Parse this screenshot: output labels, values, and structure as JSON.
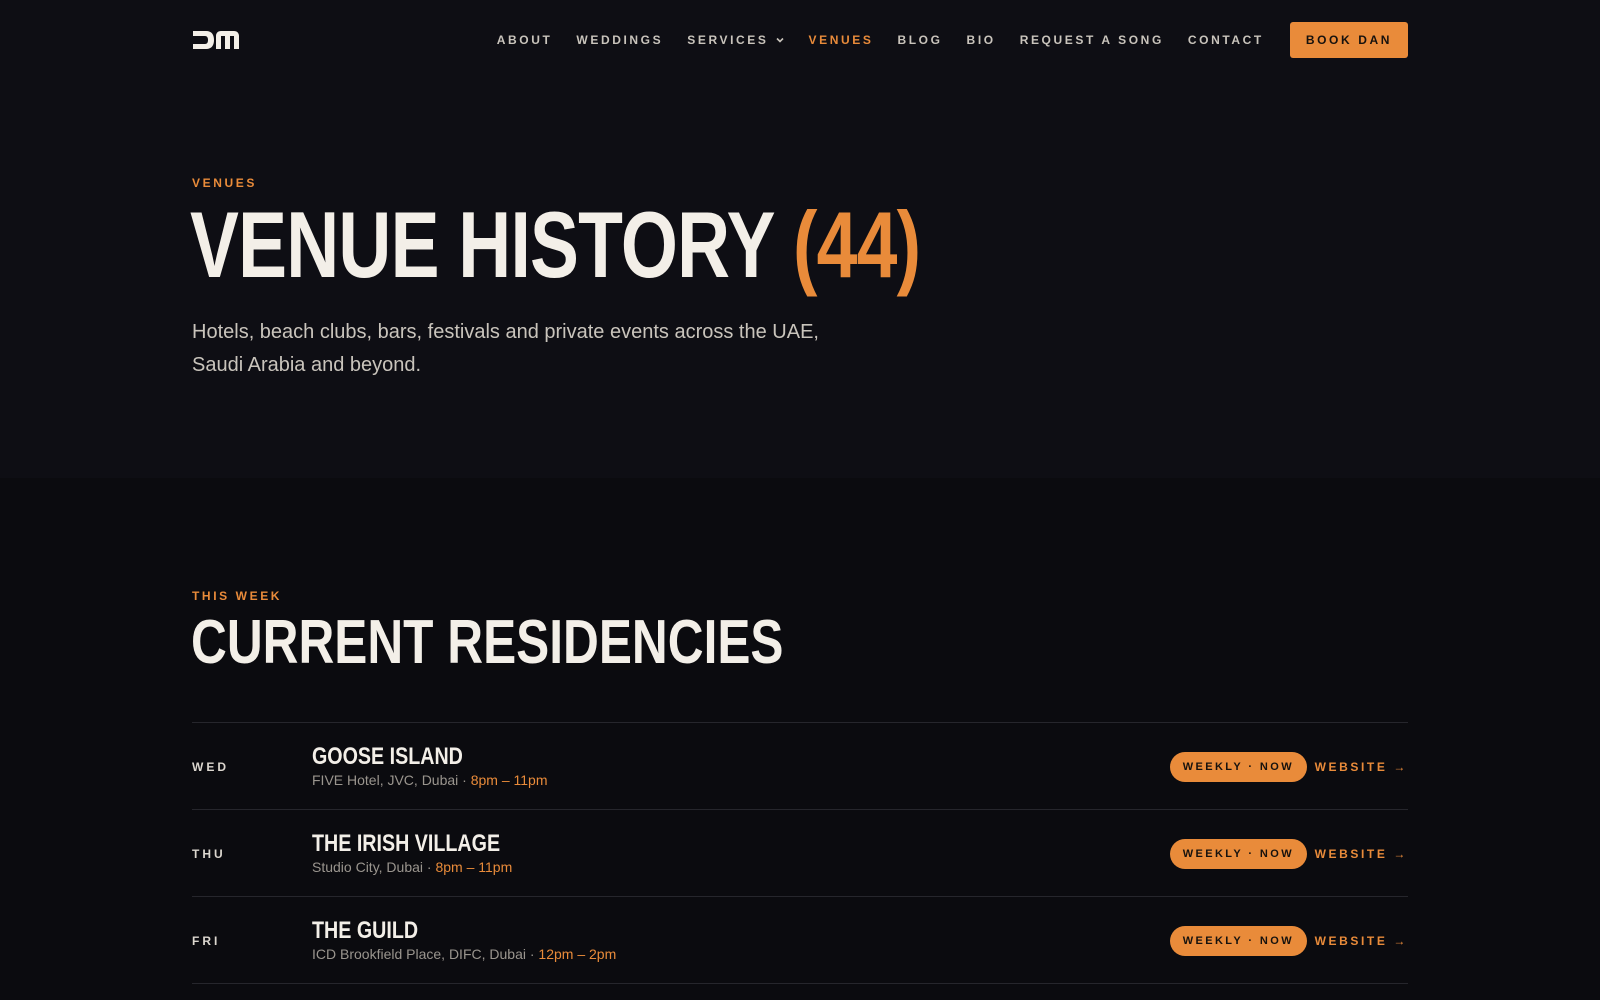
{
  "nav": {
    "items": [
      {
        "label": "ABOUT",
        "active": false
      },
      {
        "label": "WEDDINGS",
        "active": false
      },
      {
        "label": "SERVICES",
        "active": false,
        "has_dropdown": true
      },
      {
        "label": "VENUES",
        "active": true
      },
      {
        "label": "BLOG",
        "active": false
      },
      {
        "label": "BIO",
        "active": false
      },
      {
        "label": "REQUEST A SONG",
        "active": false
      },
      {
        "label": "CONTACT",
        "active": false
      }
    ],
    "book_label": "BOOK DAN"
  },
  "hero": {
    "eyebrow": "VENUES",
    "title": "VENUE HISTORY",
    "count": "(44)",
    "subtitle": "Hotels, beach clubs, bars, festivals and private events across the UAE, Saudi Arabia and beyond."
  },
  "residencies": {
    "eyebrow": "THIS WEEK",
    "title": "CURRENT RESIDENCIES",
    "rows": [
      {
        "day": "WED",
        "name": "GOOSE ISLAND",
        "location": "FIVE Hotel, JVC, Dubai · ",
        "time": "8pm – 11pm",
        "badge": "WEEKLY · NOW",
        "link": "WEBSITE →"
      },
      {
        "day": "THU",
        "name": "THE IRISH VILLAGE",
        "location": "Studio City, Dubai · ",
        "time": "8pm – 11pm",
        "badge": "WEEKLY · NOW",
        "link": "WEBSITE →"
      },
      {
        "day": "FRI",
        "name": "THE GUILD",
        "location": "ICD Brookfield Place, DIFC, Dubai · ",
        "time": "12pm – 2pm",
        "badge": "WEEKLY · NOW",
        "link": "WEBSITE →"
      }
    ]
  },
  "colors": {
    "accent": "#e98b3a",
    "background": "#0b0b0f",
    "header_bg": "#0e0e14",
    "text": "#f3efe8"
  },
  "icons": {
    "logo": "dm-logo",
    "dropdown": "chevron-down-icon"
  }
}
